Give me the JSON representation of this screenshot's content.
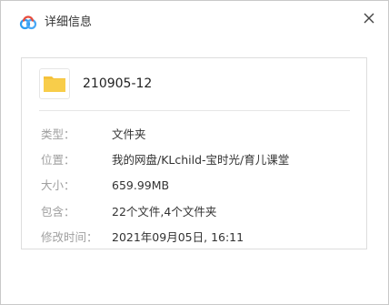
{
  "window": {
    "title": "详细信息",
    "app_icon": "baidu-netdisk-cloud-icon",
    "close_icon": "close-icon"
  },
  "file": {
    "icon": "folder-icon",
    "name": "210905-12"
  },
  "details": [
    {
      "label": "类型：",
      "value": "文件夹"
    },
    {
      "label": "位置：",
      "value": "我的网盘/KLchild-宝时光/育儿课堂"
    },
    {
      "label": "大小：",
      "value": "659.99MB"
    },
    {
      "label": "包含：",
      "value": "22个文件,4个文件夹"
    },
    {
      "label": "修改时间：",
      "value": "2021年09月05日, 16:11"
    }
  ],
  "colors": {
    "folder": "#f5c23c",
    "label": "#a0a0a0",
    "text": "#333333",
    "cloud_blue": "#2d9cf0",
    "cloud_red": "#e74c3c"
  }
}
